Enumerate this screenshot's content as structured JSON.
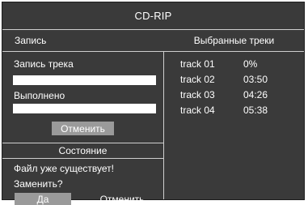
{
  "title": "CD-RIP",
  "left_header": "Запись",
  "right_header": "Выбранные треки",
  "recording": {
    "track_label": "Запись трека",
    "done_label": "Выполнено",
    "cancel_label": "Отменить"
  },
  "status": {
    "header": "Состояние",
    "message_line1": "Файл уже существует!",
    "message_line2": "Заменить?",
    "yes_label": "Да",
    "no_label": "Отменить"
  },
  "tracks": [
    {
      "name": "track 01",
      "value": "0%"
    },
    {
      "name": "track 02",
      "value": "03:50"
    },
    {
      "name": "track 03",
      "value": "04:26"
    },
    {
      "name": "track 04",
      "value": "05:38"
    }
  ]
}
